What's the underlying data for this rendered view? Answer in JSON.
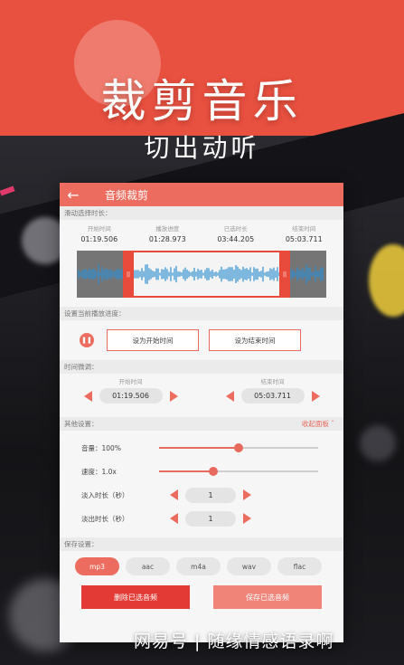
{
  "promo": {
    "title": "裁剪音乐",
    "subtitle": "切出动听"
  },
  "app": {
    "title": "音频裁剪"
  },
  "slide_section": {
    "header": "滑动选择时长：",
    "times": [
      {
        "label": "开始时间",
        "value": "01:19.506"
      },
      {
        "label": "播放进度",
        "value": "01:28.973"
      },
      {
        "label": "已选时长",
        "value": "03:44.205"
      },
      {
        "label": "结束时间",
        "value": "05:03.711"
      }
    ]
  },
  "playback": {
    "header": "设置当前播放进度：",
    "set_start": "设为开始时间",
    "set_end": "设为结束时间"
  },
  "fine_tune": {
    "header": "时间微调：",
    "start_label": "开始时间",
    "start_value": "01:19.506",
    "end_label": "结束时间",
    "end_value": "05:03.711"
  },
  "other": {
    "header": "其他设置：",
    "collapse": "收起面板",
    "volume_label": "音量：",
    "volume_value": "100%",
    "volume_level": 0.5,
    "speed_label": "速度：",
    "speed_value": "1.0x",
    "speed_level": 0.34,
    "fade_in_label": "淡入时长（秒）",
    "fade_in_value": "1",
    "fade_out_label": "淡出时长（秒）",
    "fade_out_value": "1"
  },
  "save": {
    "header": "保存设置：",
    "formats": [
      "mp3",
      "aac",
      "m4a",
      "wav",
      "flac"
    ],
    "selected": "mp3",
    "delete_label": "删除已选音频",
    "save_label": "保存已选音频"
  },
  "watermark": "网易号 | 随缘情感语录啊",
  "colors": {
    "accent": "#ec6d5f",
    "danger": "#e33a35",
    "waveform": "#2f8fd0"
  }
}
